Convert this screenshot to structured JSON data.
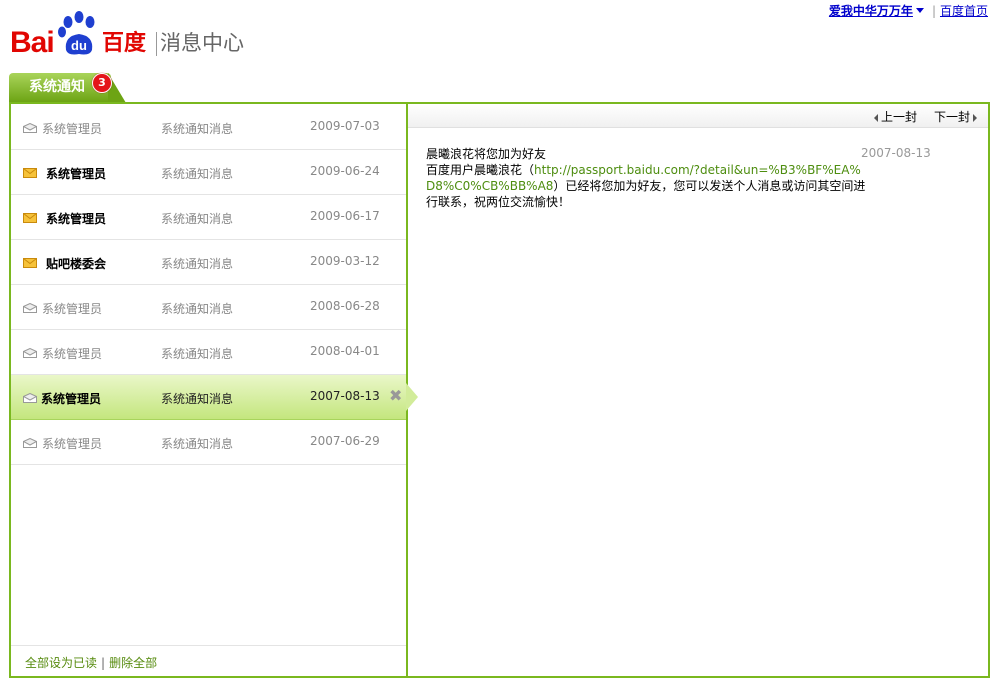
{
  "top": {
    "user": "爱我中华万万年",
    "home": "百度首页"
  },
  "logo": {
    "bai": "Bai",
    "du": "du",
    "cn": "百度",
    "title": "消息中心"
  },
  "tab": {
    "label": "系统通知",
    "badge": "3"
  },
  "messages": [
    {
      "sender": "系统管理员",
      "subject": "系统通知消息",
      "date": "2009-07-03",
      "state": "read"
    },
    {
      "sender": "系统管理员",
      "subject": "系统通知消息",
      "date": "2009-06-24",
      "state": "unread"
    },
    {
      "sender": "系统管理员",
      "subject": "系统通知消息",
      "date": "2009-06-17",
      "state": "unread"
    },
    {
      "sender": "贴吧楼委会",
      "subject": "系统通知消息",
      "date": "2009-03-12",
      "state": "unread"
    },
    {
      "sender": "系统管理员",
      "subject": "系统通知消息",
      "date": "2008-06-28",
      "state": "read"
    },
    {
      "sender": "系统管理员",
      "subject": "系统通知消息",
      "date": "2008-04-01",
      "state": "read"
    },
    {
      "sender": "系统管理员",
      "subject": "系统通知消息",
      "date": "2007-08-13",
      "state": "selected",
      "delete": "✖"
    },
    {
      "sender": "系统管理员",
      "subject": "系统通知消息",
      "date": "2007-06-29",
      "state": "read"
    }
  ],
  "footer": {
    "mark_all_read": "全部设为已读",
    "delete_all": "删除全部"
  },
  "pane": {
    "prev": "上一封",
    "next": "下一封",
    "title": "晨曦浪花将您加为好友",
    "body_prefix": "百度用户晨曦浪花（",
    "link": "http://passport.baidu.com/?detail&un=%B3%BF%EA%D8%C0%CB%BB%A8",
    "body_suffix": "）已经将您加为好友，您可以发送个人消息或访问其空间进行联系，祝两位交流愉快！",
    "date": "2007-08-13"
  },
  "colors": {
    "accent": "#7ab81f",
    "brand_red": "#e10602",
    "link_blue": "#0000cc",
    "link_green": "#4d8d0f"
  }
}
